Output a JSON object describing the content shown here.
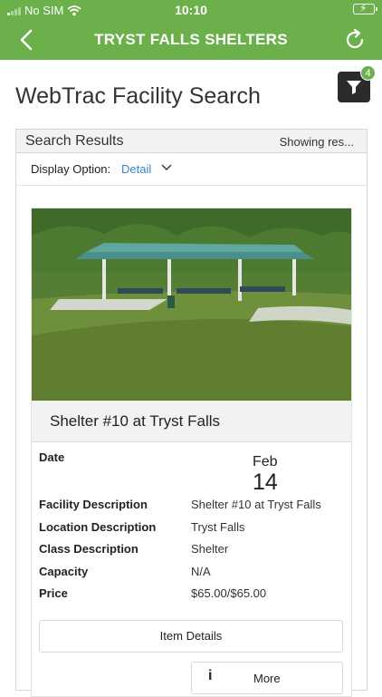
{
  "status_bar": {
    "carrier": "No SIM",
    "time": "10:10"
  },
  "nav": {
    "title": "TRYST FALLS SHELTERS"
  },
  "page": {
    "title": "WebTrac Facility Search",
    "filter_count": "4"
  },
  "results": {
    "header": "Search Results",
    "showing": "Showing res...",
    "display_option_label": "Display Option:",
    "display_option_value": "Detail"
  },
  "facility": {
    "name": "Shelter #10 at Tryst Falls",
    "date_label": "Date",
    "date_month": "Feb",
    "date_day": "14",
    "fields": [
      {
        "label": "Facility Description",
        "value": "Shelter #10 at Tryst Falls"
      },
      {
        "label": "Location Description",
        "value": "Tryst Falls"
      },
      {
        "label": "Class Description",
        "value": "Shelter"
      },
      {
        "label": "Capacity",
        "value": "N/A"
      },
      {
        "label": "Price",
        "value": "$65.00/$65.00"
      }
    ],
    "item_details_label": "Item Details",
    "more_label": "More"
  },
  "colors": {
    "brand_green": "#6cb04c",
    "link_blue": "#3a84c9",
    "dark_button": "#2b2b2b"
  },
  "icons": [
    "wifi-icon",
    "battery-icon",
    "back-icon",
    "refresh-icon",
    "filter-icon",
    "chevron-down-icon",
    "info-icon"
  ]
}
